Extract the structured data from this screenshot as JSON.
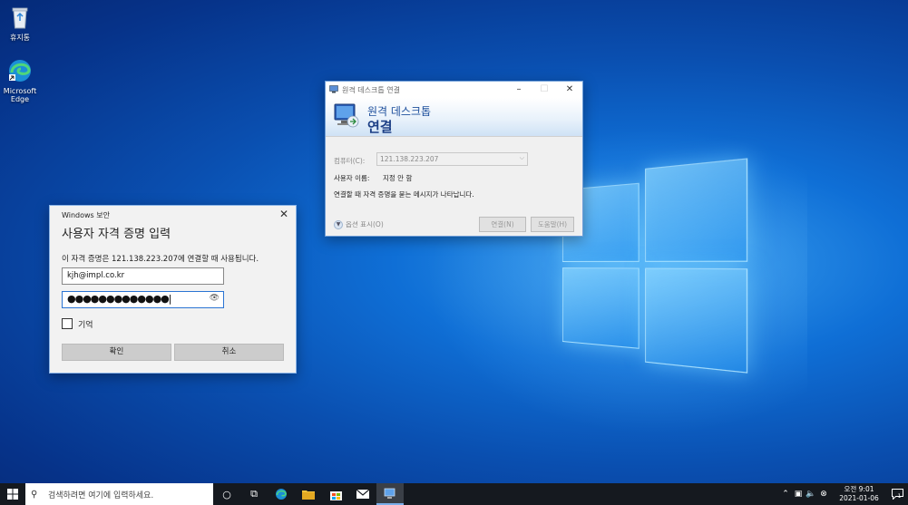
{
  "desktop": {
    "icons": [
      {
        "label": "휴지통"
      },
      {
        "label": "Microsoft Edge"
      }
    ]
  },
  "credential_dialog": {
    "window_title": "Windows 보안",
    "heading": "사용자 자격 증명 입력",
    "description": "이 자격 증명은 121.138.223.207에 연결할 때 사용됩니다.",
    "username_value": "kjh@impl.co.kr",
    "password_mask": "●●●●●●●●●●●●●",
    "remember_label": "기억",
    "ok_label": "확인",
    "cancel_label": "취소"
  },
  "rdp_dialog": {
    "window_title": "원격 데스크톱 연결",
    "banner_line1": "원격 데스크톱",
    "banner_line2": "연결",
    "computer_label": "컴퓨터(C):",
    "computer_value": "121.138.223.207",
    "username_label": "사용자 이름:",
    "username_value": "지정 안 함",
    "note": "연결할 때 자격 증명을 묻는 메시지가 나타납니다.",
    "options_label": "옵션 표시(O)",
    "connect_label": "연결(N)",
    "help_label": "도움말(H)"
  },
  "taskbar": {
    "search_placeholder": "검색하려면 여기에 입력하세요.",
    "clock_time": "오전 9:01",
    "clock_date": "2021-01-06",
    "notification_count": "1"
  },
  "colors": {
    "accent": "#2b74d3",
    "taskbar": "#15191f",
    "rdp_banner_text": "#1d3f86"
  }
}
